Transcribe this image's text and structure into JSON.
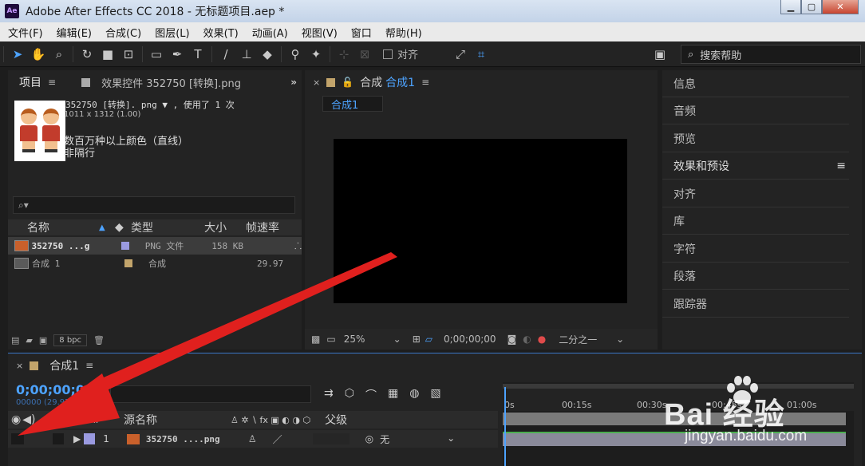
{
  "window": {
    "title": "Adobe After Effects CC 2018 - 无标题项目.aep *",
    "logo": "Ae",
    "controls": [
      "minimize",
      "maximize",
      "close"
    ]
  },
  "menu": [
    "文件(F)",
    "编辑(E)",
    "合成(C)",
    "图层(L)",
    "效果(T)",
    "动画(A)",
    "视图(V)",
    "窗口",
    "帮助(H)"
  ],
  "toolbar": {
    "align_label": "对齐",
    "search_help_placeholder": "搜索帮助"
  },
  "project": {
    "tab_project": "项目",
    "tab_effects": "效果控件 352750 [转换].png",
    "asset_name": "352750 [转换]. png ▼ , 使用了 1 次",
    "asset_dims": "1011 x 1312 (1.00)",
    "asset_color": "数百万种以上颜色（直线）",
    "asset_field": "非隔行",
    "columns": {
      "name": "名称",
      "type": "类型",
      "size": "大小",
      "fps": "帧速率"
    },
    "rows": [
      {
        "name": "352750 ...g",
        "type": "PNG 文件",
        "size": "158 KB",
        "fps": "",
        "label_color": "#9a9ae0"
      },
      {
        "name": "合成 1",
        "type": "合成",
        "size": "",
        "fps": "29.97",
        "label_color": "#c2a46b"
      }
    ],
    "bpc": "8 bpc"
  },
  "viewer": {
    "tab_label": "合成",
    "tab_comp": "合成1",
    "comp_pill": "合成1",
    "zoom": "25%",
    "timecode": "0;00;00;00",
    "resolution": "二分之一"
  },
  "right_panel": {
    "items": [
      "信息",
      "音频",
      "预览",
      "效果和预设",
      "对齐",
      "库",
      "字符",
      "段落",
      "跟踪器"
    ]
  },
  "timeline": {
    "tab": "合成1",
    "timecode": "0;00;00;00",
    "timecode_sub": "00000 (29.97 fps)",
    "columns": {
      "index": "#",
      "source": "源名称",
      "parent": "父级"
    },
    "layer": {
      "index": "1",
      "name": "352750 ....png",
      "parent": "无"
    },
    "ruler": [
      "0s",
      "00:15s",
      "00:30s",
      "00:45s",
      "01:00s"
    ]
  },
  "watermark": {
    "logo": "Bai 经验",
    "url": "jingyan.baidu.com"
  },
  "colors": {
    "accent_blue": "#4da3ff",
    "arrow_red": "#e0201e"
  }
}
